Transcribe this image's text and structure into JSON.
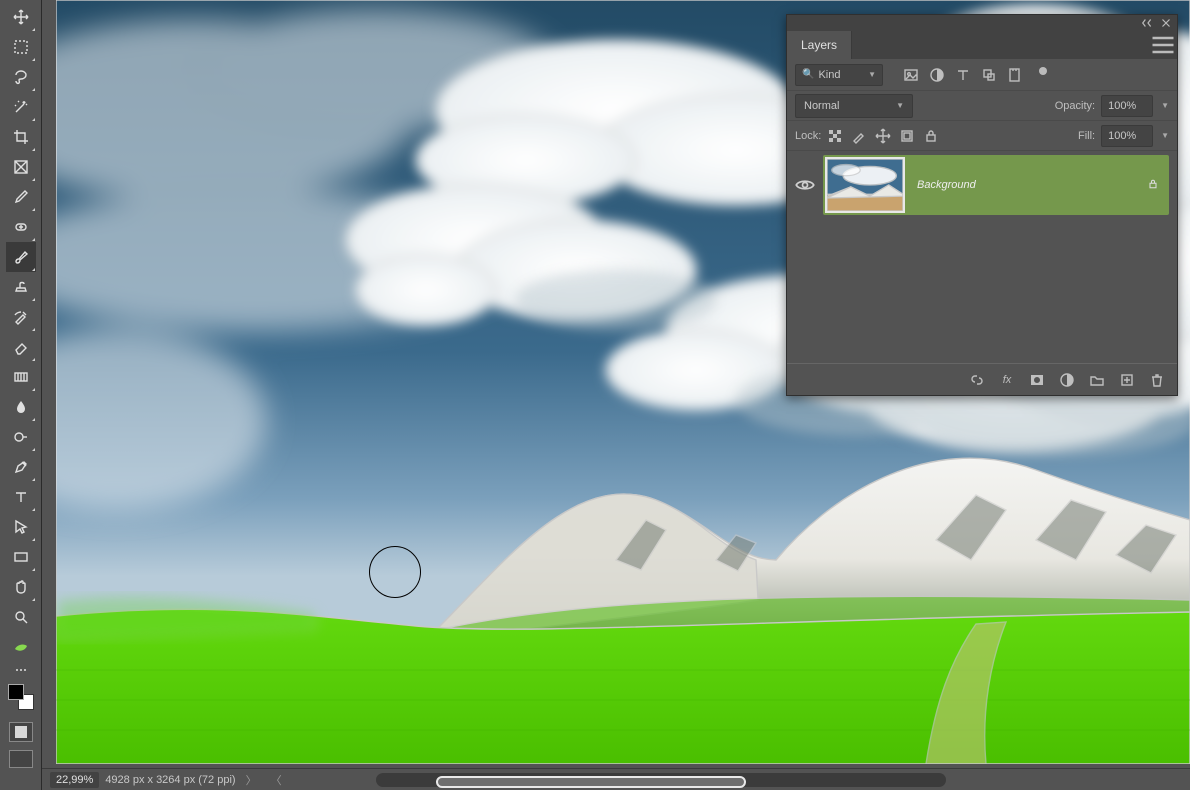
{
  "status": {
    "zoom": "22,99%",
    "dimensions": "4928 px x 3264 px (72 ppi)"
  },
  "tools": [
    {
      "name": "move-tool"
    },
    {
      "name": "marquee-tool"
    },
    {
      "name": "lasso-tool"
    },
    {
      "name": "magic-wand-tool"
    },
    {
      "name": "crop-tool"
    },
    {
      "name": "frame-tool"
    },
    {
      "name": "eyedropper-tool"
    },
    {
      "name": "healing-brush-tool"
    },
    {
      "name": "brush-tool",
      "active": true
    },
    {
      "name": "clone-stamp-tool"
    },
    {
      "name": "history-brush-tool"
    },
    {
      "name": "eraser-tool"
    },
    {
      "name": "gradient-tool"
    },
    {
      "name": "blur-tool"
    },
    {
      "name": "dodge-tool"
    },
    {
      "name": "pen-tool"
    },
    {
      "name": "type-tool"
    },
    {
      "name": "path-selection-tool"
    },
    {
      "name": "rectangle-tool"
    },
    {
      "name": "hand-tool"
    },
    {
      "name": "zoom-tool"
    },
    {
      "name": "edit-toolbar"
    }
  ],
  "layers_panel": {
    "tab_label": "Layers",
    "kind_label": "Kind",
    "blend_mode": "Normal",
    "opacity_label": "Opacity:",
    "opacity_value": "100%",
    "lock_label": "Lock:",
    "fill_label": "Fill:",
    "fill_value": "100%",
    "layers": [
      {
        "name": "Background",
        "locked": true
      }
    ]
  },
  "colors": {
    "foreground": "#000000",
    "background": "#ffffff",
    "grass": "#56d900",
    "sky_top": "#1f4664",
    "sky_bottom": "#a9c3d6",
    "layer_highlight": "#75984c"
  }
}
